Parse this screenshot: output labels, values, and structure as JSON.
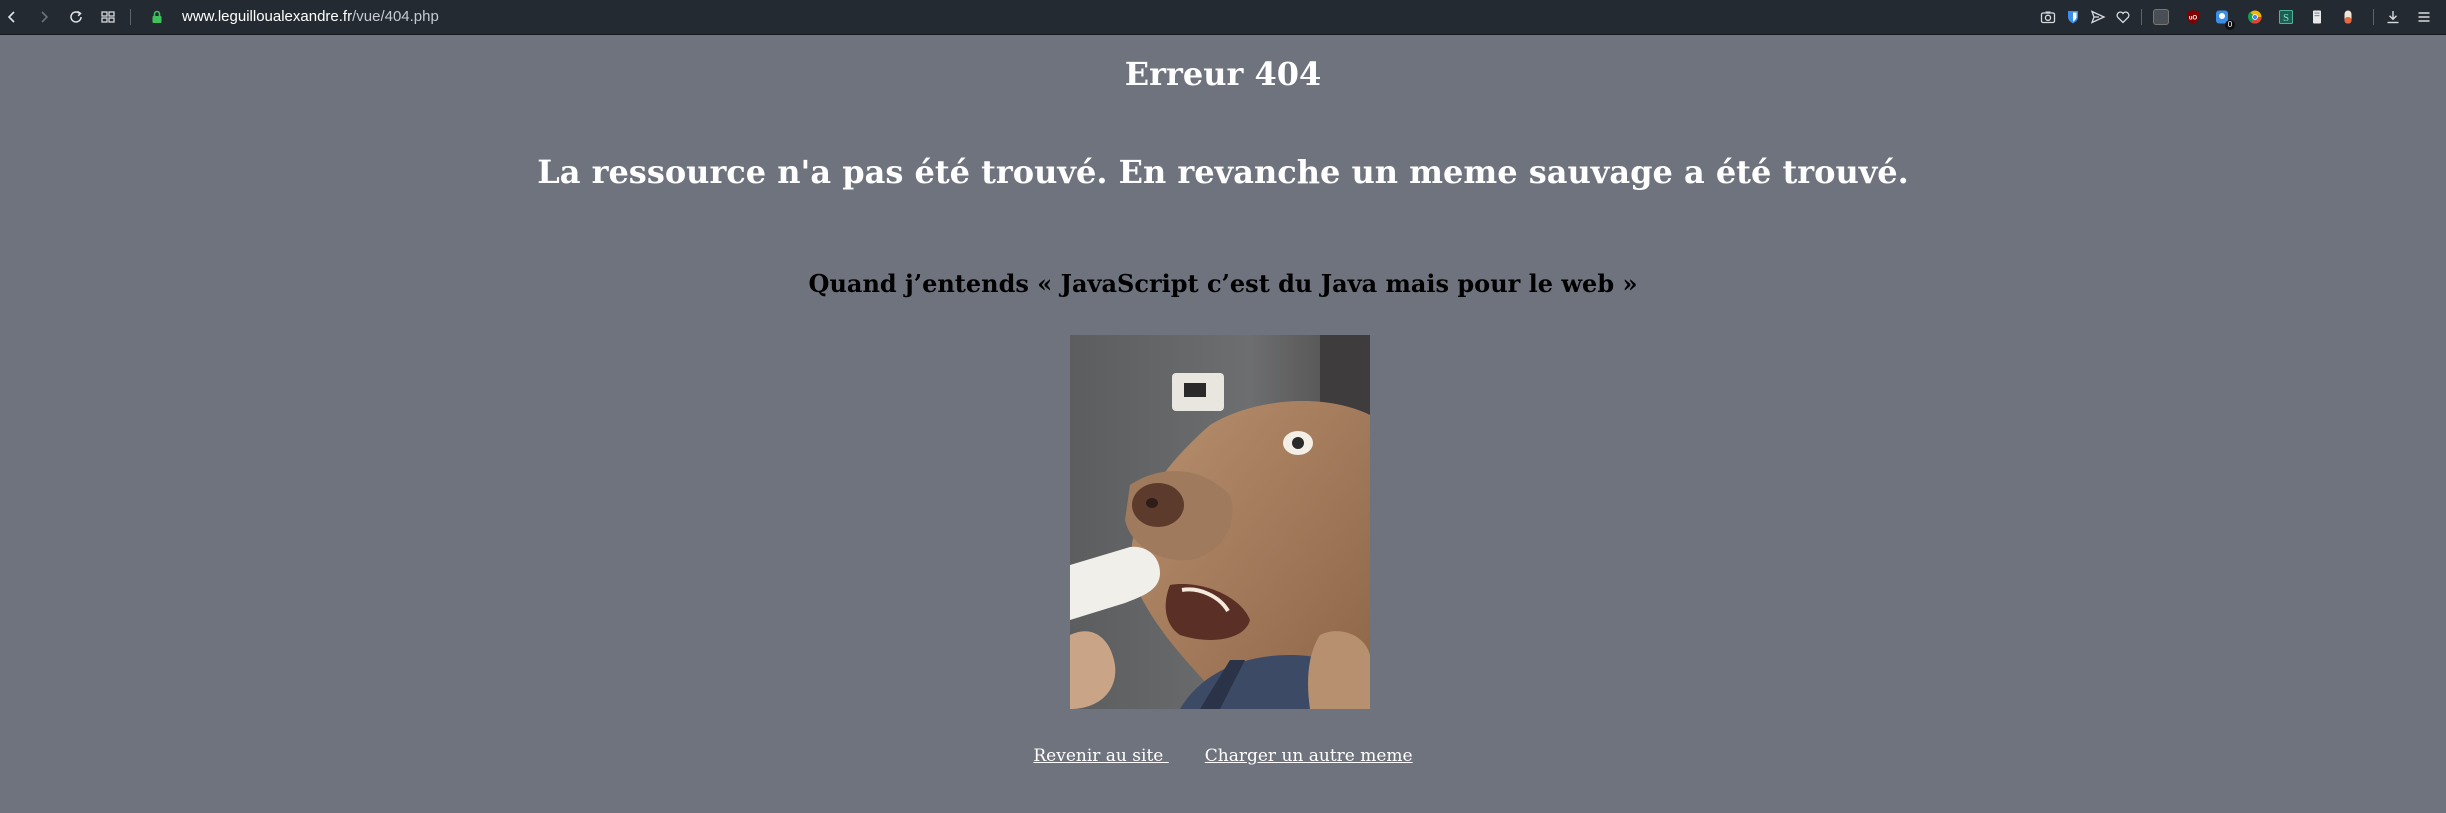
{
  "browser": {
    "url_host": "www.leguilloualexandre.fr",
    "url_path": "/vue/404.php",
    "extensions": [
      "camera-icon",
      "bitwarden-icon",
      "send-icon",
      "heart-icon",
      "colorpicker-icon",
      "ublock-icon",
      "privacy-badger-icon",
      "translate-icon",
      "stylus-icon",
      "notes-icon",
      "pill-icon",
      "download-icon",
      "menu-icon"
    ],
    "privacy_badge_count": "0"
  },
  "page": {
    "title": "Erreur 404",
    "message": "La ressource n'a pas été trouvé. En revanche un meme sauvage a été trouvé.",
    "meme_caption": "Quand j’entends « JavaScript c’est du Java mais pour le web »",
    "links": {
      "back": "Revenir au site ",
      "reload": "Charger un autre meme"
    }
  },
  "colors": {
    "page_bg": "#6f737e",
    "toolbar_bg": "#232a31"
  }
}
